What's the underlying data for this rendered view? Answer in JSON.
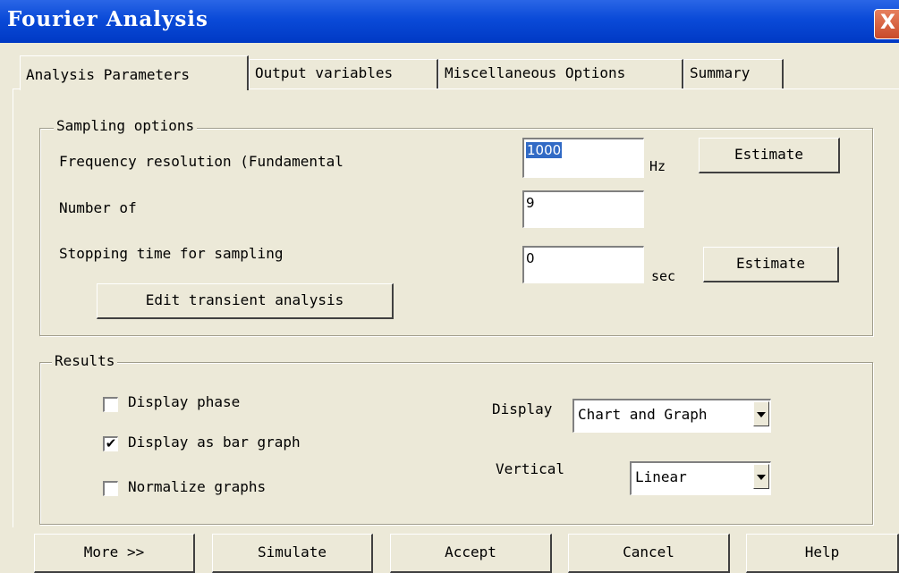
{
  "window": {
    "title": "Fourier Analysis",
    "close_glyph": "X"
  },
  "tabs": [
    {
      "label": "Analysis Parameters",
      "active": true
    },
    {
      "label": "Output variables",
      "active": false
    },
    {
      "label": "Miscellaneous Options",
      "active": false
    },
    {
      "label": "Summary",
      "active": false
    }
  ],
  "sampling": {
    "group_label": "Sampling options",
    "freq_label": "Frequency resolution (Fundamental",
    "freq_value": "1000",
    "freq_unit": "Hz",
    "estimate_label": "Estimate",
    "num_label": "Number of",
    "num_value": "9",
    "stop_label": "Stopping time for sampling",
    "stop_value": "0",
    "stop_unit": "sec",
    "estimate2_label": "Estimate",
    "edit_transient_label": "Edit transient analysis"
  },
  "results": {
    "group_label": "Results",
    "display_phase_label": "Display phase",
    "display_phase_checked": false,
    "bar_graph_label": "Display as bar graph",
    "bar_graph_checked": true,
    "normalize_label": "Normalize graphs",
    "normalize_checked": false,
    "display_label": "Display",
    "display_value": "Chart and Graph",
    "vertical_label": "Vertical",
    "vertical_value": "Linear",
    "check_glyph": "✔"
  },
  "buttons": {
    "more": "More >>",
    "simulate": "Simulate",
    "accept": "Accept",
    "cancel": "Cancel",
    "help": "Help"
  }
}
